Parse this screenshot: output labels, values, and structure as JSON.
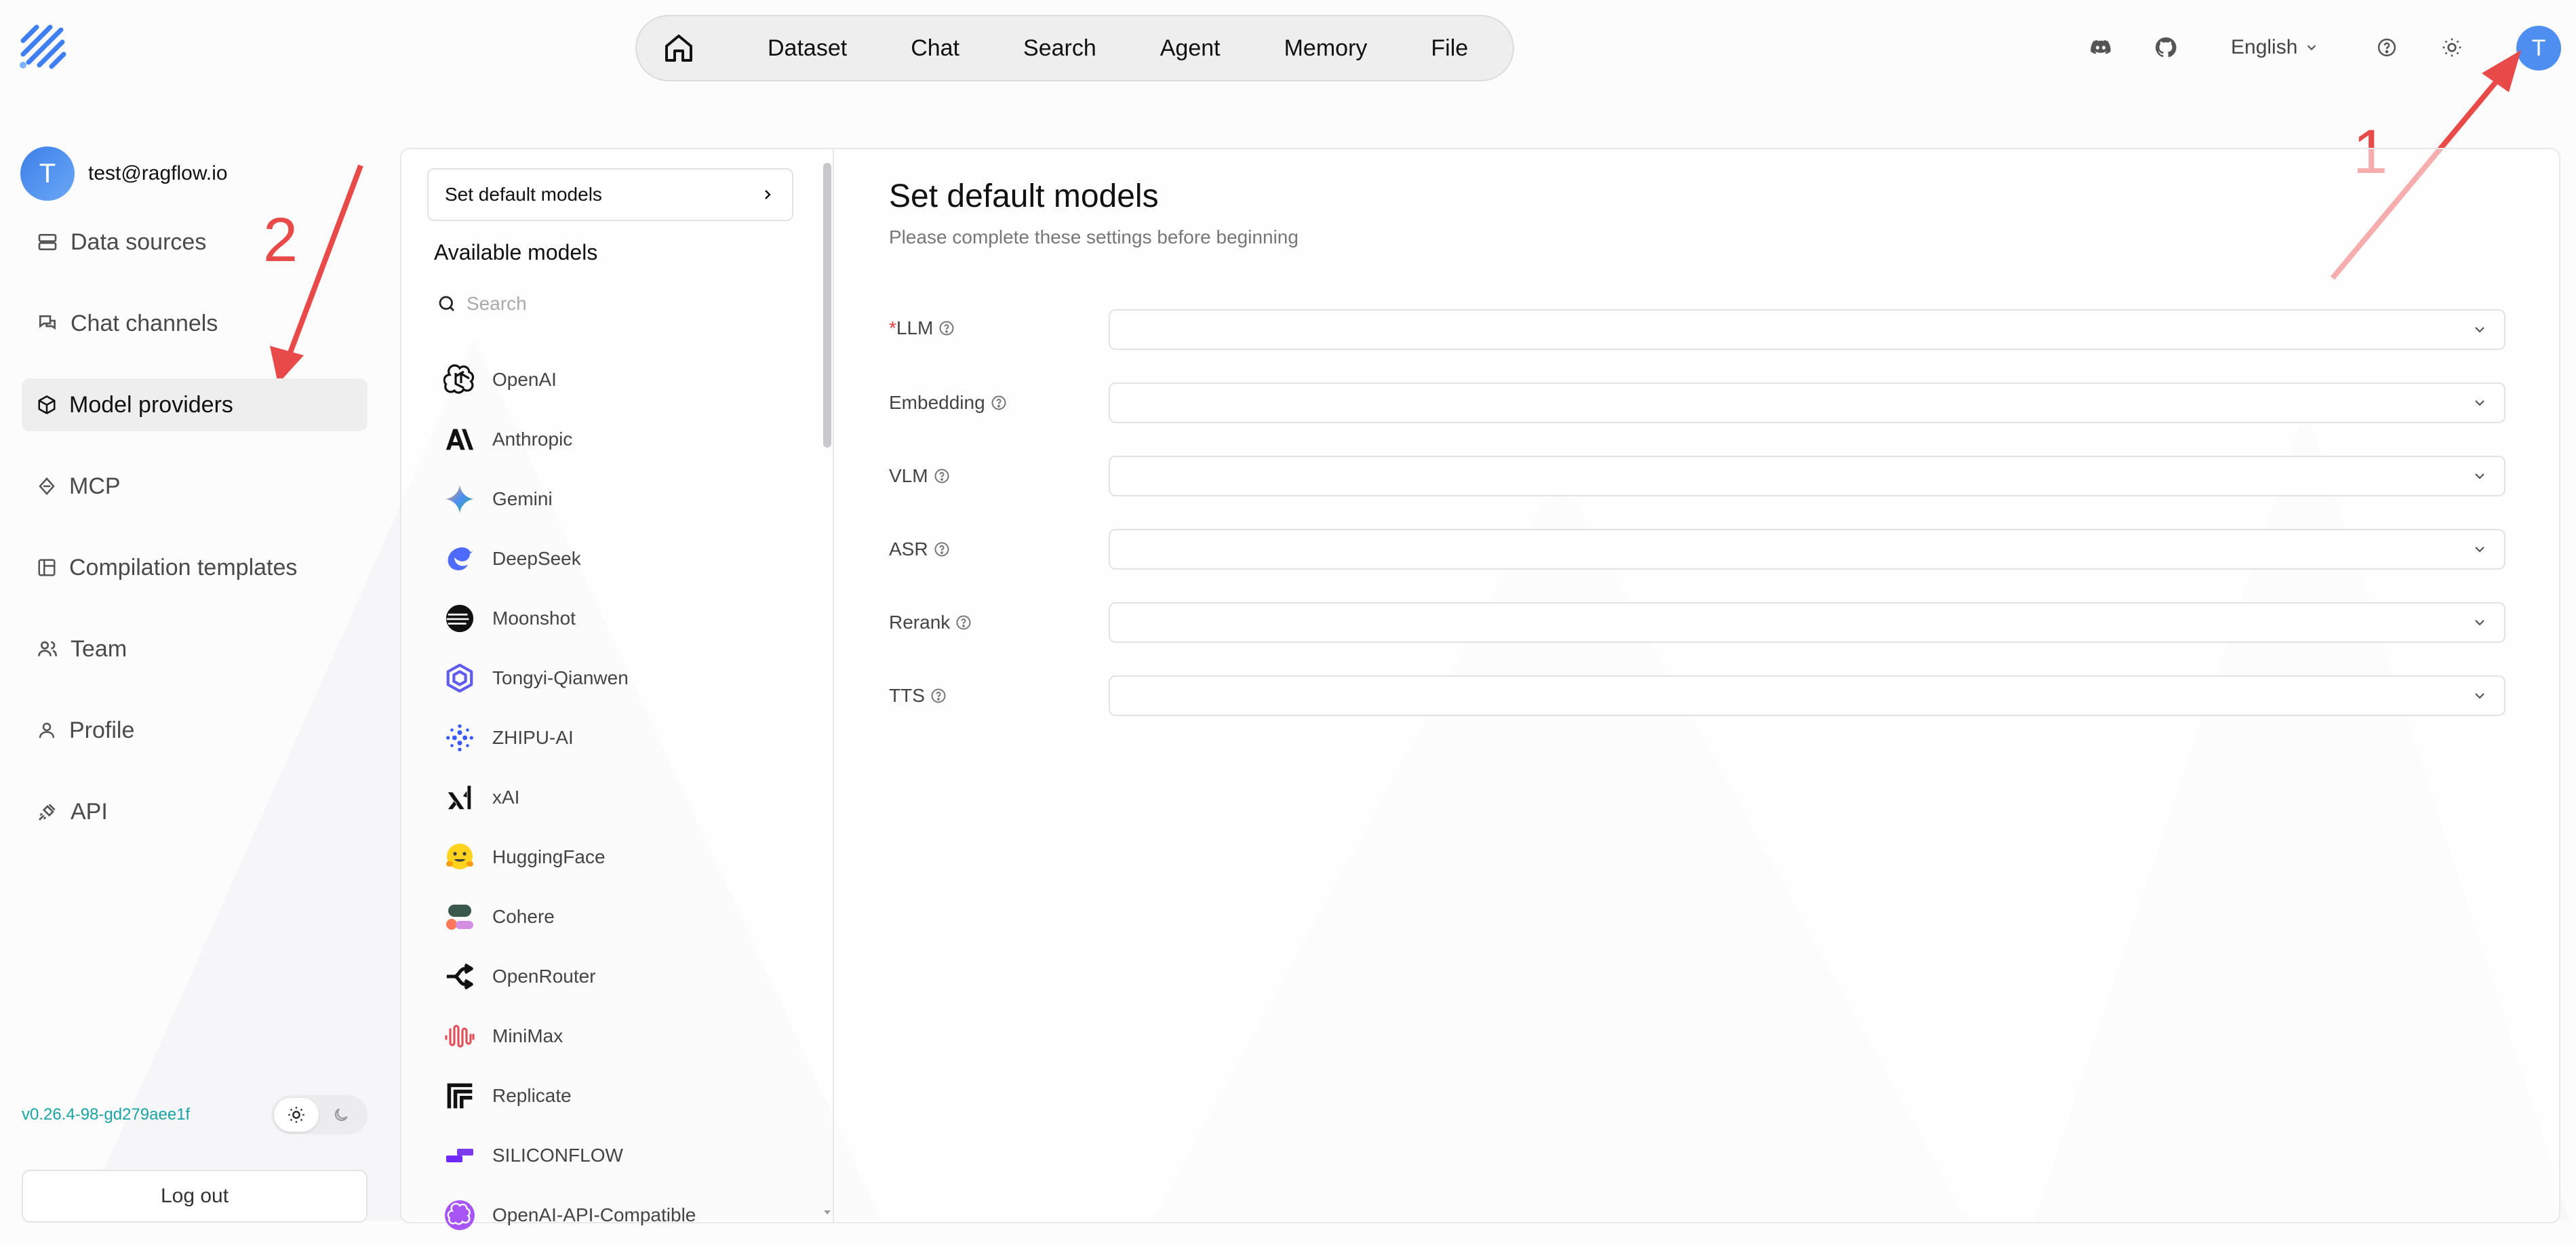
{
  "nav": {
    "items": [
      "Dataset",
      "Chat",
      "Search",
      "Agent",
      "Memory",
      "File"
    ]
  },
  "header": {
    "language": "English",
    "avatar_initial": "T"
  },
  "user": {
    "initial": "T",
    "email": "test@ragflow.io"
  },
  "sidebar": {
    "items": [
      {
        "label": "Data sources",
        "icon": "database-icon"
      },
      {
        "label": "Chat channels",
        "icon": "chat-channels-icon"
      },
      {
        "label": "Model providers",
        "icon": "cube-icon",
        "active": true
      },
      {
        "label": "MCP",
        "icon": "mcp-icon"
      },
      {
        "label": "Compilation templates",
        "icon": "template-icon"
      },
      {
        "label": "Team",
        "icon": "team-icon"
      },
      {
        "label": "Profile",
        "icon": "user-icon"
      },
      {
        "label": "API",
        "icon": "plug-icon"
      }
    ],
    "version": "v0.26.4-98-gd279aee1f",
    "logout_label": "Log out"
  },
  "annotations": {
    "one": "1",
    "two": "2"
  },
  "models_panel": {
    "set_default_label": "Set default models",
    "available_title": "Available models",
    "search_placeholder": "Search",
    "providers": [
      "OpenAI",
      "Anthropic",
      "Gemini",
      "DeepSeek",
      "Moonshot",
      "Tongyi-Qianwen",
      "ZHIPU-AI",
      "xAI",
      "HuggingFace",
      "Cohere",
      "OpenRouter",
      "MiniMax",
      "Replicate",
      "SILICONFLOW",
      "OpenAI-API-Compatible"
    ]
  },
  "main": {
    "title": "Set default models",
    "subtitle": "Please complete these settings before beginning",
    "fields": [
      {
        "label": "LLM",
        "required": true
      },
      {
        "label": "Embedding",
        "required": false
      },
      {
        "label": "VLM",
        "required": false
      },
      {
        "label": "ASR",
        "required": false
      },
      {
        "label": "Rerank",
        "required": false
      },
      {
        "label": "TTS",
        "required": false
      }
    ]
  },
  "colors": {
    "accent": "#4d8ef0",
    "annotation_red": "#e84a4a",
    "version_teal": "#1aa3a3",
    "required_red": "#e53e3e"
  }
}
